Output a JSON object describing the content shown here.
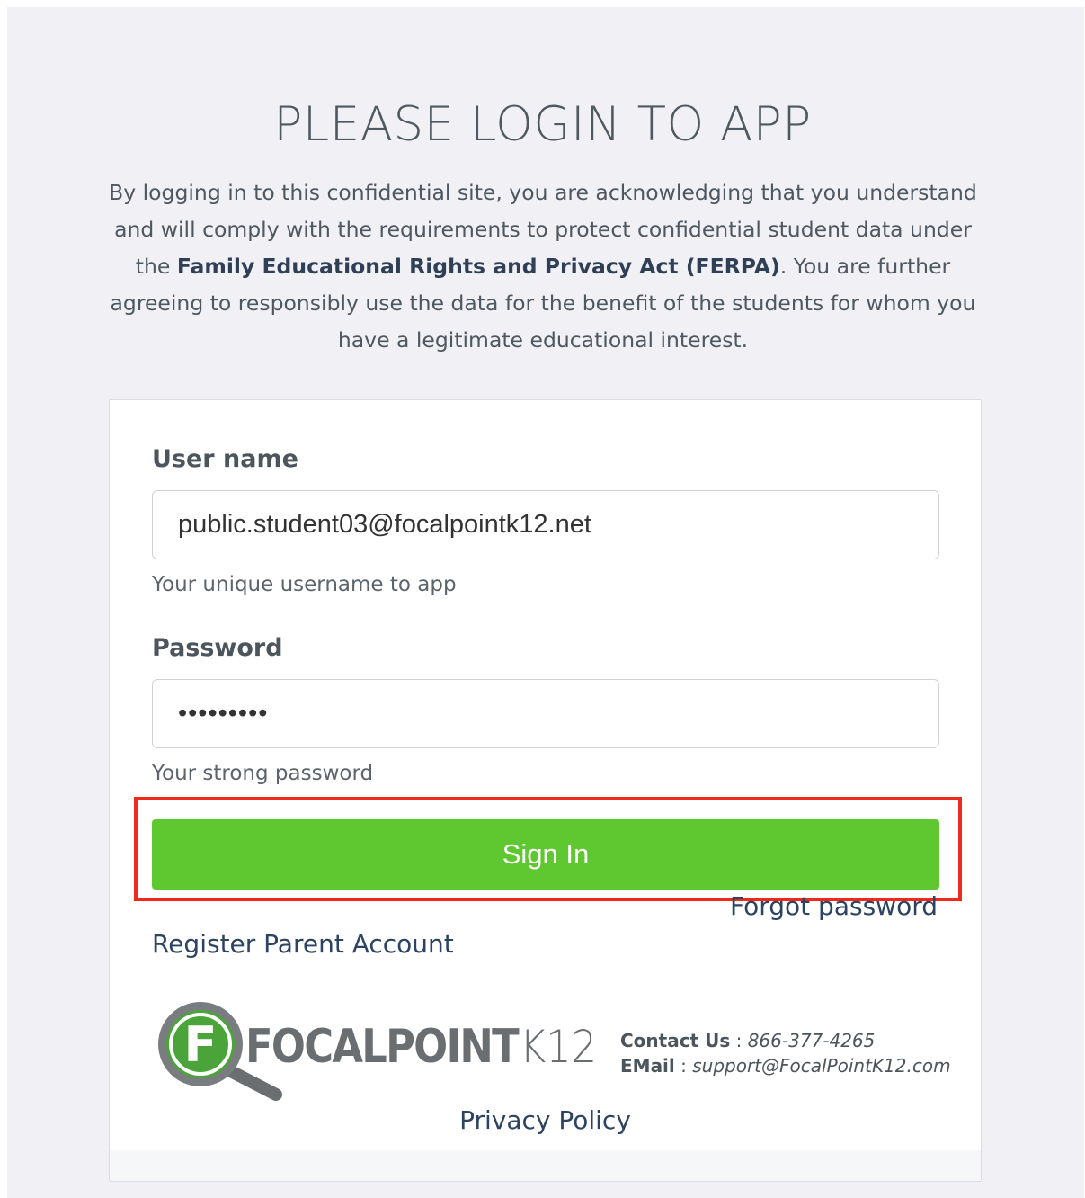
{
  "page": {
    "title": "PLEASE LOGIN TO APP",
    "notice": {
      "part1": "By logging in to this confidential site, you are acknowledging that you understand and will comply with the requirements to protect confidential student data under the ",
      "ferpa_link": "Family Educational Rights and Privacy Act (FERPA)",
      "part2": ". You are further agreeing to responsibly use the data for the benefit of the students for whom you have a legitimate educational interest."
    }
  },
  "form": {
    "username_label": "User name",
    "username_value": "public.student03@focalpointk12.net",
    "username_help": "Your unique username to app",
    "password_label": "Password",
    "password_value": "•••••••••",
    "password_help": "Your strong password",
    "signin_label": "Sign In",
    "forgot_label": "Forgot password",
    "register_label": "Register Parent Account"
  },
  "footer": {
    "logo_text": "FOCALPOINT",
    "logo_suffix": "K12",
    "logo_letter": "F",
    "contact_label": "Contact Us",
    "contact_sep": " : ",
    "contact_value": "866-377-4265",
    "email_label": "EMail",
    "email_sep": " : ",
    "email_value": "support@FocalPointK12.com",
    "privacy_label": "Privacy Policy"
  },
  "colors": {
    "accent_green": "#5fc72f",
    "highlight_red": "#ee2a1c",
    "link_navy": "#2c4361",
    "logo_green": "#4aa43a",
    "logo_gray": "#6b6e70"
  }
}
